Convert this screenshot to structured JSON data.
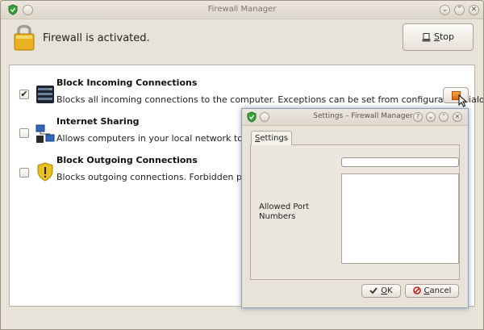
{
  "window": {
    "title": "Firewall Manager"
  },
  "header": {
    "status": "Firewall is activated.",
    "stop_label": "Stop",
    "stop_accel": "S",
    "stop_rest": "top"
  },
  "rules": [
    {
      "title": "Block Incoming Connections",
      "description": "Blocks all incoming connections to the computer. Exceptions can be set from configuration dialog.",
      "checked": true,
      "icon": "server-icon"
    },
    {
      "title": "Internet Sharing",
      "description": "Allows computers in your local network to conne",
      "checked": false,
      "icon": "network-share-icon"
    },
    {
      "title": "Block Outgoing Connections",
      "description": "Blocks outgoing connections. Forbidden ports c",
      "checked": false,
      "icon": "warning-shield-icon"
    }
  ],
  "dialog": {
    "title": "Settings – Firewall Manager",
    "tab_label": "Settings",
    "tab_accel": "S",
    "tab_rest": "ettings",
    "port_label": "Allowed Port Numbers",
    "ok_label": "OK",
    "ok_accel": "O",
    "ok_rest": "K",
    "cancel_label": "Cancel",
    "cancel_accel": "C",
    "cancel_rest": "ancel"
  },
  "colors": {
    "accent": "#e07a1a",
    "shield_green": "#2e9a2e",
    "dialog_glow": "#5a80b8"
  }
}
